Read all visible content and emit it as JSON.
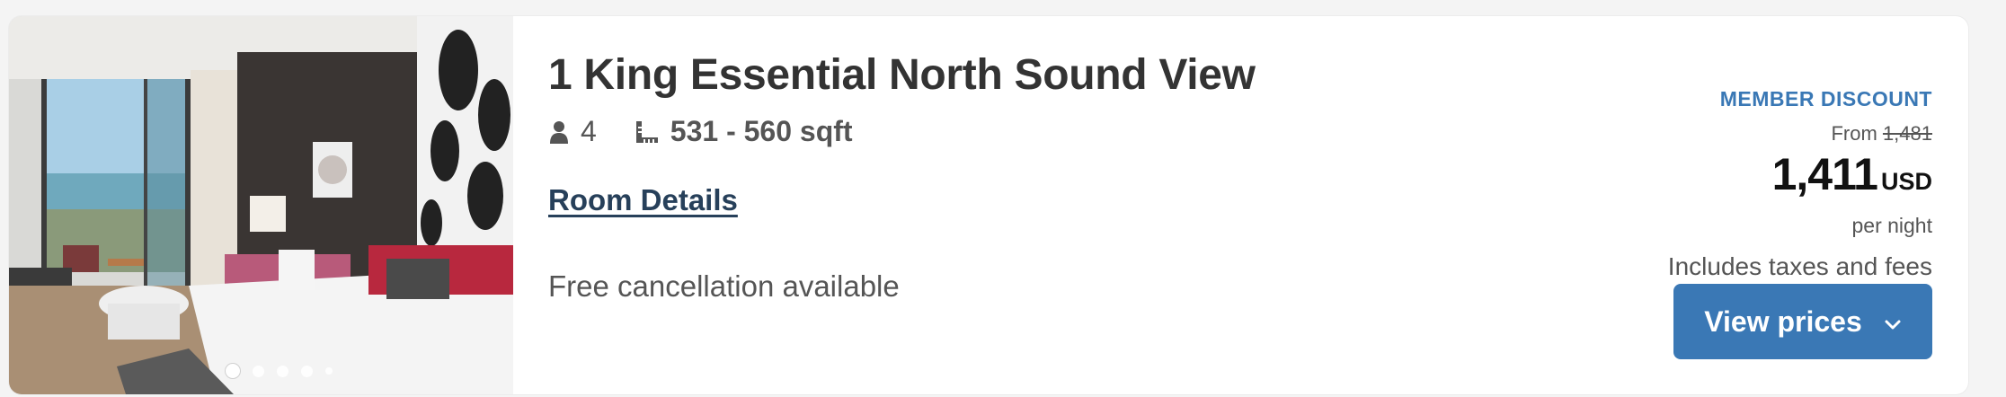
{
  "room": {
    "title": "1 King Essential North Sound View",
    "guests": "4",
    "size": "531 - 560 sqft",
    "details_link": "Room Details",
    "cancellation": "Free cancellation available"
  },
  "gallery": {
    "total_slides": 5,
    "active_index": 0
  },
  "pricing": {
    "badge": "MEMBER DISCOUNT",
    "from_label": "From",
    "original_price": "1,481",
    "price": "1,411",
    "currency": "USD",
    "per_night": "per night",
    "taxes_note": "Includes taxes and fees",
    "button_label": "View prices"
  },
  "icons": {
    "guests": "person-icon",
    "size": "ruler-area-icon",
    "button": "chevron-down-icon"
  },
  "colors": {
    "accent": "#3a78b5",
    "link": "#27405a",
    "title": "#333333"
  }
}
